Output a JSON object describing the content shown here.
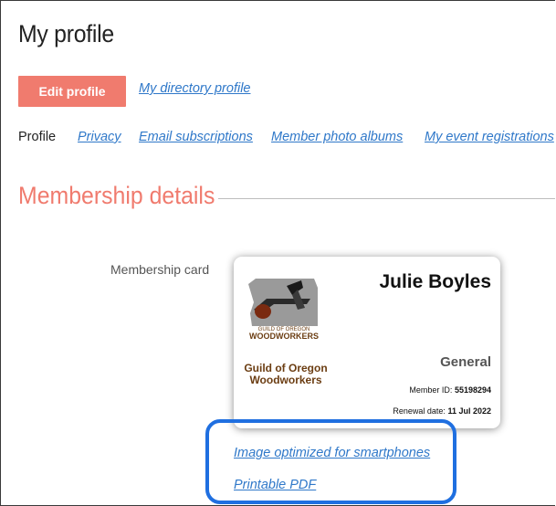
{
  "header": {
    "title": "My profile"
  },
  "actions": {
    "edit_label": "Edit profile",
    "directory_link": "My directory profile"
  },
  "tabs": [
    {
      "label": "Profile",
      "current": true
    },
    {
      "label": "Privacy"
    },
    {
      "label": "Email subscriptions"
    },
    {
      "label": "Member photo albums"
    },
    {
      "label": "My event registrations"
    }
  ],
  "section": {
    "title": "Membership details"
  },
  "card": {
    "field_label": "Membership card",
    "logo_text": [
      "GUILD OF OREGON",
      "WOODWORKERS"
    ],
    "org_name": "Guild of Oregon Woodworkers",
    "member_name": "Julie Boyles",
    "level": "General",
    "member_id_label": "Member ID:",
    "member_id": "55198294",
    "renewal_label": "Renewal date:",
    "renewal_date": "11 Jul 2022"
  },
  "card_links": {
    "image": "Image optimized for smartphones",
    "pdf": "Printable PDF"
  },
  "colors": {
    "accent": "#f07b6e",
    "link": "#2f78c9",
    "highlight": "#1f6fe0",
    "brand_brown": "#6b3d12"
  }
}
